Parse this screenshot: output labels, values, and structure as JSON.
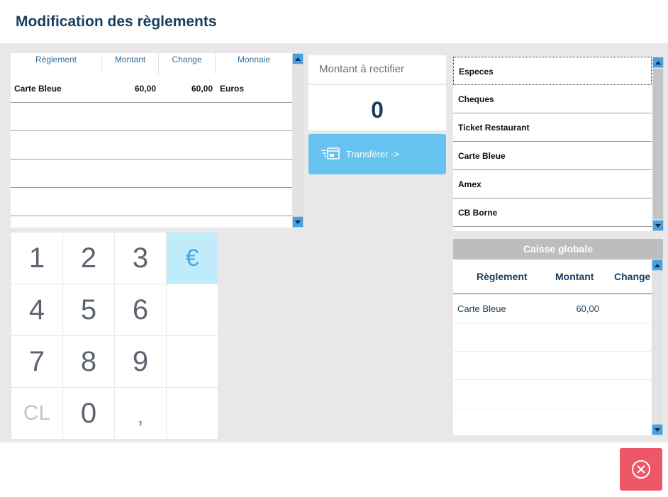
{
  "header": {
    "title": "Modification des règlements"
  },
  "left_table": {
    "columns": [
      "Règlement",
      "Montant",
      "Change",
      "Monnaie"
    ],
    "rows": [
      {
        "reglement": "Carte Bleue",
        "montant": "60,00",
        "change": "60,00",
        "monnaie": "Euros"
      }
    ]
  },
  "keypad": {
    "keys": [
      "1",
      "2",
      "3",
      "€",
      "4",
      "5",
      "6",
      "",
      "7",
      "8",
      "9",
      "",
      "CL",
      "0",
      ",",
      ""
    ]
  },
  "amount": {
    "label": "Montant à rectifier",
    "value": "0"
  },
  "transfer": {
    "label": "Transférer ->",
    "icon": "transfer-payment-icon"
  },
  "methods": {
    "items": [
      "Especes",
      "Cheques",
      "Ticket Restaurant",
      "Carte Bleue",
      "Amex",
      "CB Borne"
    ],
    "selected_index": 0
  },
  "caisse_globale": {
    "title": "Caisse globale",
    "columns": [
      "Règlement",
      "Montant",
      "Change"
    ],
    "rows": [
      {
        "reglement": "Carte Bleue",
        "montant": "60,00",
        "change": ""
      }
    ]
  },
  "close_button": {
    "icon": "close-circle-icon"
  },
  "colors": {
    "title": "#1b3e5c",
    "background": "#e9e7e8",
    "transfer_button": "#66c3ef",
    "euro_key": "#c0ebfb",
    "close_button": "#ee5767",
    "scroll_button": "#4a9fe0"
  }
}
